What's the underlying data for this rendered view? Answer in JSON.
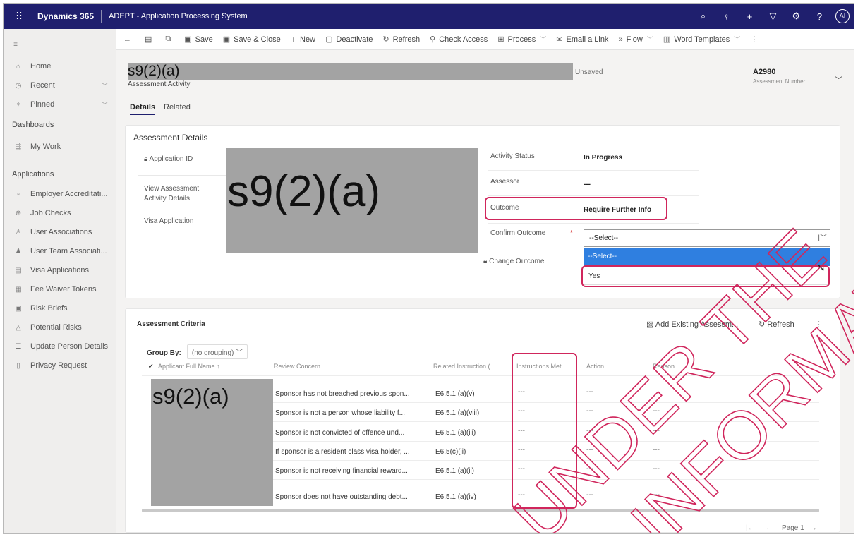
{
  "topbar": {
    "waffle_icon": "app-launcher-icon",
    "brand": "Dynamics 365",
    "app_name": "ADEPT - Application Processing System",
    "icons": [
      "search-icon",
      "lightbulb-icon",
      "plus-icon",
      "filter-icon",
      "gear-icon",
      "help-icon"
    ],
    "avatar_initials": "AI",
    "bg_color": "#1f1f6e"
  },
  "sidebar": {
    "items": [
      {
        "label": "Home",
        "icon": "home-icon"
      },
      {
        "label": "Recent",
        "icon": "clock-icon"
      },
      {
        "label": "Pinned",
        "icon": "pin-icon"
      }
    ],
    "dashboards_heading": "Dashboards",
    "dashboard_items": [
      {
        "label": "My Work",
        "icon": "work-icon"
      }
    ],
    "applications_heading": "Applications",
    "app_items": [
      {
        "label": "Employer Accreditati...",
        "icon": "building-icon"
      },
      {
        "label": "Job Checks",
        "icon": "job-icon"
      },
      {
        "label": "User Associations",
        "icon": "user-icon"
      },
      {
        "label": "User Team Associati...",
        "icon": "team-icon"
      },
      {
        "label": "Visa Applications",
        "icon": "document-icon"
      },
      {
        "label": "Fee Waiver Tokens",
        "icon": "token-icon"
      },
      {
        "label": "Risk Briefs",
        "icon": "brief-icon"
      },
      {
        "label": "Potential Risks",
        "icon": "warning-icon"
      },
      {
        "label": "Update Person Details",
        "icon": "person-icon"
      },
      {
        "label": "Privacy Request",
        "icon": "privacy-icon"
      }
    ]
  },
  "cmdbar": {
    "items": [
      {
        "label": "Save",
        "icon": "save-icon"
      },
      {
        "label": "Save & Close",
        "icon": "save-close-icon"
      },
      {
        "label": "New",
        "icon": "plus-icon"
      },
      {
        "label": "Deactivate",
        "icon": "deactivate-icon"
      },
      {
        "label": "Refresh",
        "icon": "refresh-icon"
      },
      {
        "label": "Check Access",
        "icon": "check-access-icon"
      },
      {
        "label": "Process",
        "icon": "process-icon"
      },
      {
        "label": "Email a Link",
        "icon": "email-icon"
      },
      {
        "label": "Flow",
        "icon": "flow-icon"
      },
      {
        "label": "Word Templates",
        "icon": "word-icon"
      }
    ]
  },
  "header": {
    "title": "s9(2)(a)",
    "entity": "Assessment Activity",
    "status": "Unsaved",
    "number": "A2980",
    "number_label": "Assessment Number"
  },
  "tabs": [
    {
      "label": "Details"
    },
    {
      "label": "Related"
    }
  ],
  "details": {
    "section_title": "Assessment Details",
    "links": [
      "Application ID",
      "View Assessment Activity Details",
      "Visa Application"
    ],
    "redaction_text": "s9(2)(a)",
    "fields": {
      "activity_status_label": "Activity Status",
      "activity_status_value": "In Progress",
      "assessor_label": "Assessor",
      "assessor_value": "---",
      "outcome_label": "Outcome",
      "outcome_value": "Require Further Info",
      "confirm_label": "Confirm Outcome",
      "required_mark": "*",
      "confirm_value": "--Select--",
      "change_outcome_label": "Change Outcome"
    },
    "dropdown_options": [
      "--Select--",
      "Yes"
    ]
  },
  "grid": {
    "title": "Assessment Criteria",
    "add_existing": "Add Existing Assessm...",
    "refresh": "Refresh",
    "group_by_label": "Group By:",
    "group_by_value": "(no grouping)",
    "columns": [
      "Applicant Full Name ↑",
      "Review Concern",
      "Related Instruction (...",
      "Instructions Met",
      "Action",
      "Reason"
    ],
    "redaction_text": "s9(2)(a)",
    "rows": [
      {
        "concern": "Sponsor has not breached previous spon...",
        "instruction": "E6.5.1 (a)(v)",
        "met": "---",
        "action": "---",
        "reason": ""
      },
      {
        "concern": "Sponsor is not a person whose liability f...",
        "instruction": "E6.5.1 (a)(viii)",
        "met": "---",
        "action": "---",
        "reason": "---"
      },
      {
        "concern": "Sponsor is not convicted of offence und...",
        "instruction": "E6.5.1 (a)(iii)",
        "met": "---",
        "action": "---",
        "reason": "---"
      },
      {
        "concern": "If sponsor is a resident class visa holder, ...",
        "instruction": "E6.5(c)(ii)",
        "met": "---",
        "action": "---",
        "reason": "---"
      },
      {
        "concern": "Sponsor is not receiving financial reward...",
        "instruction": "E6.5.1 (a)(ii)",
        "met": "---",
        "action": "---",
        "reason": "---"
      },
      {
        "concern": "Sponsor does not have outstanding debt...",
        "instruction": "E6.5.1 (a)(iv)",
        "met": "---",
        "action": "---",
        "reason": "---"
      }
    ],
    "page_label": "Page 1"
  },
  "watermark": {
    "line1": "UNDER THE",
    "line2": "INFORMATION ACT",
    "color": "#d0265c"
  },
  "colors": {
    "highlight": "#d0265c",
    "selected_option": "#2f7fe0"
  }
}
